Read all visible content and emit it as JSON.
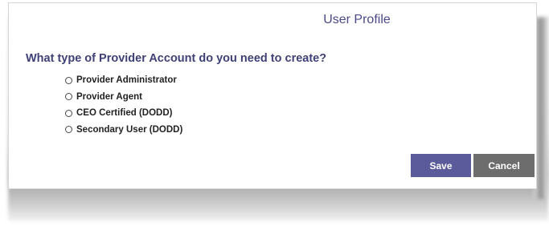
{
  "dialog": {
    "title": "User Profile",
    "question": "What type of Provider Account do you need to create?",
    "options": [
      {
        "label": "Provider Administrator",
        "selected": false
      },
      {
        "label": "Provider Agent",
        "selected": false
      },
      {
        "label": "CEO Certified (DODD)",
        "selected": false
      },
      {
        "label": "Secondary User (DODD)",
        "selected": false
      }
    ],
    "save_label": "Save",
    "cancel_label": "Cancel"
  },
  "colors": {
    "title": "#4b4a86",
    "question": "#3f4177",
    "save_button": "#5b5b9b",
    "cancel_button": "#6d6d6d"
  }
}
